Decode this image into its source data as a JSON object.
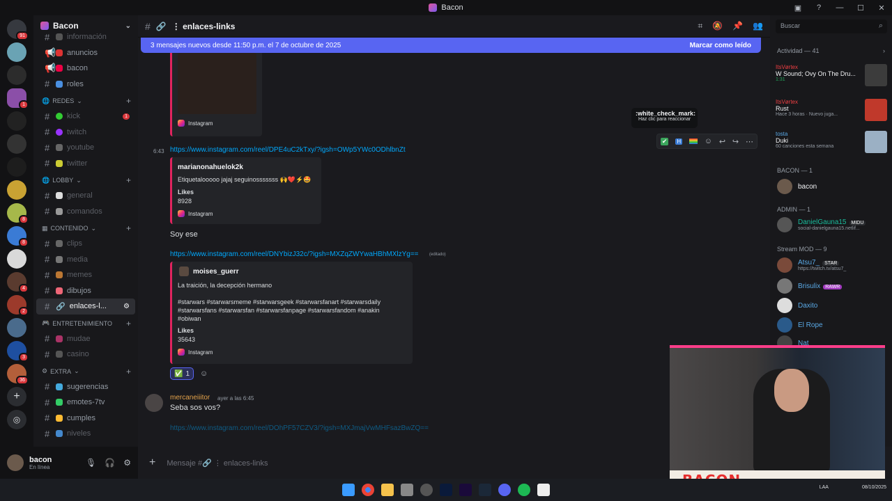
{
  "window": {
    "title": "Bacon"
  },
  "guild": {
    "name": "Bacon"
  },
  "sidebar": {
    "top_items": [
      {
        "label": "información",
        "muted": true
      },
      {
        "label": "anuncios"
      },
      {
        "label": "bacon"
      },
      {
        "label": "roles"
      }
    ],
    "categories": [
      {
        "name": "REDES",
        "items": [
          {
            "label": "kick",
            "badge": "1",
            "muted": true
          },
          {
            "label": "twitch",
            "muted": true
          },
          {
            "label": "youtube",
            "muted": true
          },
          {
            "label": "twitter",
            "muted": true
          }
        ]
      },
      {
        "name": "LOBBY",
        "items": [
          {
            "label": "general",
            "muted": true
          },
          {
            "label": "comandos",
            "muted": true
          }
        ]
      },
      {
        "name": "CONTENIDO",
        "items": [
          {
            "label": "clips",
            "muted": true
          },
          {
            "label": "media",
            "muted": true
          },
          {
            "label": "memes",
            "muted": true
          },
          {
            "label": "dibujos"
          },
          {
            "label": "enlaces-l...",
            "active": true
          }
        ]
      },
      {
        "name": "ENTRETENIMIENTO",
        "items": [
          {
            "label": "mudae",
            "muted": true
          },
          {
            "label": "casino",
            "muted": true
          }
        ]
      },
      {
        "name": "EXTRA",
        "items": [
          {
            "label": "sugerencias"
          },
          {
            "label": "emotes-7tv"
          },
          {
            "label": "cumples"
          },
          {
            "label": "niveles",
            "muted": true
          }
        ]
      }
    ]
  },
  "server_badges": [
    "91",
    "1",
    "8",
    "8",
    "4",
    "8",
    "2",
    "8",
    "3",
    "36"
  ],
  "user": {
    "name": "bacon",
    "status": "En línea"
  },
  "channel": {
    "name": "⋮ enlaces-links"
  },
  "newbar": {
    "text": "3 mensajes nuevos desde 11:50 p.m. el 7 de octubre de 2025",
    "action": "Marcar como leído"
  },
  "messages": {
    "embed1": {
      "provider": "Instagram"
    },
    "msg1": {
      "time": "6:43",
      "link": "https://www.instagram.com/reel/DPE4uC2kTxy/?igsh=OWp5YWc0ODhlbnZt",
      "author": "marianonahuelok2k",
      "body": "Etiquetalooooo jajaj seguinosssssss 🙌❤️⚡🤩",
      "likes_label": "Likes",
      "likes": "8928",
      "provider": "Instagram"
    },
    "msg2": {
      "text": "Soy ese"
    },
    "msg3": {
      "link": "https://www.instagram.com/reel/DNYbizJ32c/?igsh=MXZqZWYwaHBhMXlzYg==",
      "edited": "(editado)",
      "author": "moises_guerr",
      "line1": "La traición, la decepción hermano",
      "line2": "#starwars #starwarsmeme #starwarsgeek #starwarsfanart #starwarsdaily",
      "line3": "#starwarsfans #starwarsfan #starwarsfanpage #starwarsfandom #anakin",
      "line4": "#obiwan",
      "likes_label": "Likes",
      "likes": "35643",
      "provider": "Instagram",
      "reaction_emoji": "✅",
      "reaction_count": "1"
    },
    "msg4": {
      "author": "mercaneiiitor",
      "time": "ayer a las 6:45",
      "text": "Seba sos vos?",
      "link": "https://www.instagram.com/reel/DOhPF57CZV3/?igsh=MXJmajVwMHFsazBwZQ=="
    }
  },
  "tooltip": {
    "title": ":white_check_mark:",
    "sub": "Haz clic para reaccionar"
  },
  "input": {
    "placeholder": "Mensaje #🔗 ⋮ enlaces-links"
  },
  "right": {
    "search": "Buscar",
    "activity_header": "Actividad — 41",
    "activities": [
      {
        "name": "ItsVørtex",
        "title": "W Sound; Ovy On The Dru...",
        "detail": "1:31"
      },
      {
        "name": "ItsVørtex",
        "title": "Rust",
        "detail": "Hace 3 horas · Nuevo juga..."
      },
      {
        "name": "tosta",
        "title": "Duki",
        "detail": "60 canciones esta semana"
      }
    ],
    "groups": [
      {
        "label": "BACON — 1"
      },
      {
        "label": "ADMIN — 1"
      },
      {
        "label": "Stream MOD — 9"
      }
    ],
    "members": {
      "bacon": "bacon",
      "daniel": "DanielGauna15",
      "daniel_tag": "MIDU",
      "daniel_sub": "social-danielgauna15.netlif...",
      "atsu": "Atsu7_",
      "atsu_tag": "STAR",
      "atsu_sub": "https://twitch.tv/atsu7_",
      "brisulix": "Brisulix",
      "brisulix_tag": "RAWR",
      "daxito": "Daxito",
      "elrope": "El Rope",
      "nat": "Nat"
    }
  },
  "webcam": {
    "label": "BACON"
  },
  "taskbar": {
    "lang": "LAA",
    "date": "08/10/2025"
  }
}
